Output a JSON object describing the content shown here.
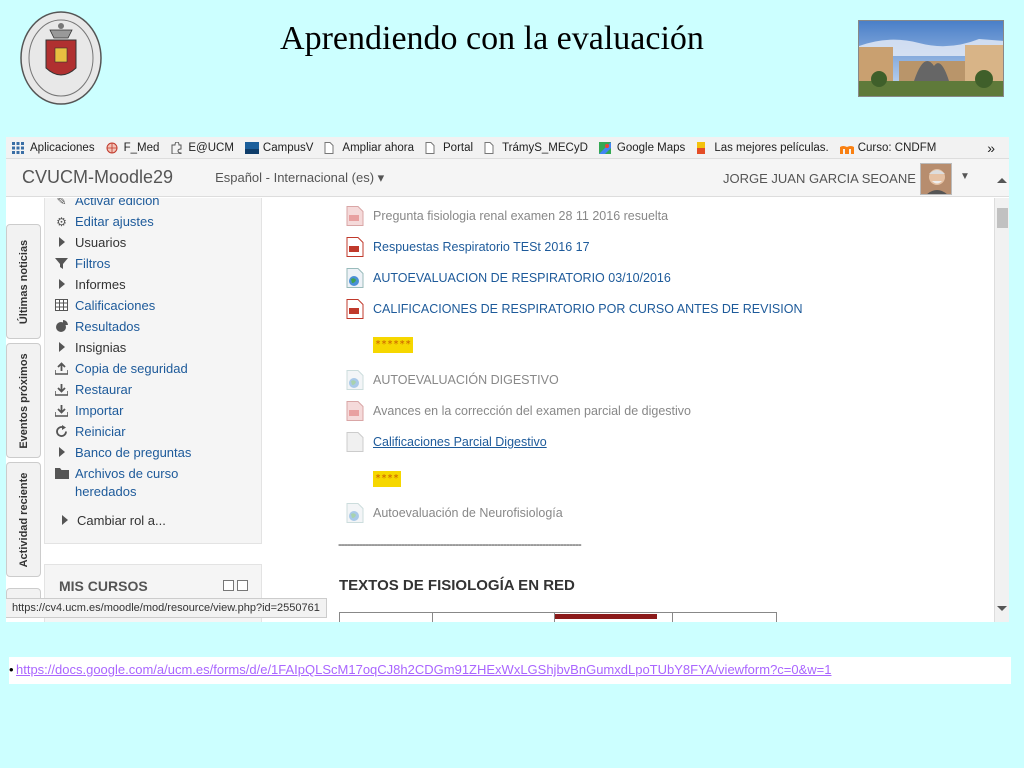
{
  "slide": {
    "title": "Aprendiendo con la evaluación",
    "bottom_bullet": "•",
    "bottom_link": "https://docs.google.com/a/ucm.es/forms/d/e/1FAIpQLScM17oqCJ8h2CDGm91ZHExWxLGShjbvBnGumxdLpoTUbY8FYA/viewform?c=0&w=1"
  },
  "bookmarks": [
    {
      "label": "Aplicaciones",
      "icon": "apps-grid-icon",
      "color": "#3a6ea5"
    },
    {
      "label": "F_Med",
      "icon": "globe-icon",
      "color": "#c0392b"
    },
    {
      "label": "E@UCM",
      "icon": "puzzle-icon",
      "color": "#555555"
    },
    {
      "label": "CampusV",
      "icon": "campus-icon",
      "color": "#1b5e9a"
    },
    {
      "label": "Ampliar ahora",
      "icon": "page-icon",
      "color": "#777777"
    },
    {
      "label": "Portal",
      "icon": "page-icon",
      "color": "#777777"
    },
    {
      "label": "TrámyS_MECyD",
      "icon": "page-icon",
      "color": "#777777"
    },
    {
      "label": "Google Maps",
      "icon": "maps-icon",
      "color": "#34a853"
    },
    {
      "label": "Las mejores películas.",
      "icon": "film-icon",
      "color": "#e44d26"
    },
    {
      "label": "Curso: CNDFM",
      "icon": "moodle-icon",
      "color": "#f98012"
    }
  ],
  "bookmarks_more": "»",
  "moodle": {
    "brand": "CVUCM-Moodle29",
    "language": "Español - Internacional (es) ▾",
    "user": "JORGE JUAN GARCIA SEOANE",
    "user_caret": "▼"
  },
  "dock_tabs": [
    "Últimas noticias",
    "Eventos próximos",
    "Actividad reciente"
  ],
  "admin_menu": [
    {
      "label": "Activar edición",
      "icon": "pencil-icon",
      "type": "link"
    },
    {
      "label": "Editar ajustes",
      "icon": "gear-icon",
      "type": "link"
    },
    {
      "label": "Usuarios",
      "icon": "caret-right-icon",
      "type": "dark"
    },
    {
      "label": "Filtros",
      "icon": "filter-icon",
      "type": "link"
    },
    {
      "label": "Informes",
      "icon": "caret-right-icon",
      "type": "dark"
    },
    {
      "label": "Calificaciones",
      "icon": "grades-table-icon",
      "type": "link"
    },
    {
      "label": "Resultados",
      "icon": "pie-icon",
      "type": "link"
    },
    {
      "label": "Insignias",
      "icon": "caret-right-icon",
      "type": "dark"
    },
    {
      "label": "Copia de seguridad",
      "icon": "upload-icon",
      "type": "link"
    },
    {
      "label": "Restaurar",
      "icon": "download-icon",
      "type": "link"
    },
    {
      "label": "Importar",
      "icon": "download-icon",
      "type": "link"
    },
    {
      "label": "Reiniciar",
      "icon": "refresh-icon",
      "type": "link"
    },
    {
      "label": "Banco de preguntas",
      "icon": "caret-right-icon",
      "type": "link"
    },
    {
      "label": "Archivos de curso",
      "label2": "heredados",
      "icon": "folder-icon",
      "type": "link"
    }
  ],
  "cambiar_rol": "Cambiar rol a...",
  "mis_cursos": "MIS CURSOS",
  "resources": [
    {
      "label": "Pregunta fisiologia renal examen 28 11 2016 resuelta",
      "icon": "pdf-icon",
      "style": "dimmed"
    },
    {
      "label": "Respuestas Respiratorio TESt 2016 17",
      "icon": "pdf-icon",
      "style": "linked"
    },
    {
      "label": "AUTOEVALUACION DE RESPIRATORIO 03/10/2016",
      "icon": "url-globe-icon",
      "style": "linked"
    },
    {
      "label": "CALIFICACIONES DE RESPIRATORIO POR CURSO ANTES DE REVISION",
      "icon": "pdf-icon",
      "style": "linked"
    },
    {
      "label": "AUTOEVALUACIÓN DIGESTIVO",
      "icon": "url-globe-icon",
      "style": "dimmed"
    },
    {
      "label": "Avances en la corrección del examen parcial de digestivo",
      "icon": "pdf-icon",
      "style": "dimmed"
    },
    {
      "label": "Calificaciones Parcial Digestivo",
      "icon": "file-icon",
      "style": "underlined"
    },
    {
      "label": "Autoevaluación de Neurofisiología",
      "icon": "url-globe-icon",
      "style": "dimmed"
    }
  ],
  "stars": [
    "******",
    "****"
  ],
  "dashes": "---------------------------------------------------------------------------------",
  "section_heading": "TEXTOS DE FISIOLOGÍA EN RED",
  "status_url": "https://cv4.ucm.es/moodle/mod/resource/view.php?id=2550761"
}
